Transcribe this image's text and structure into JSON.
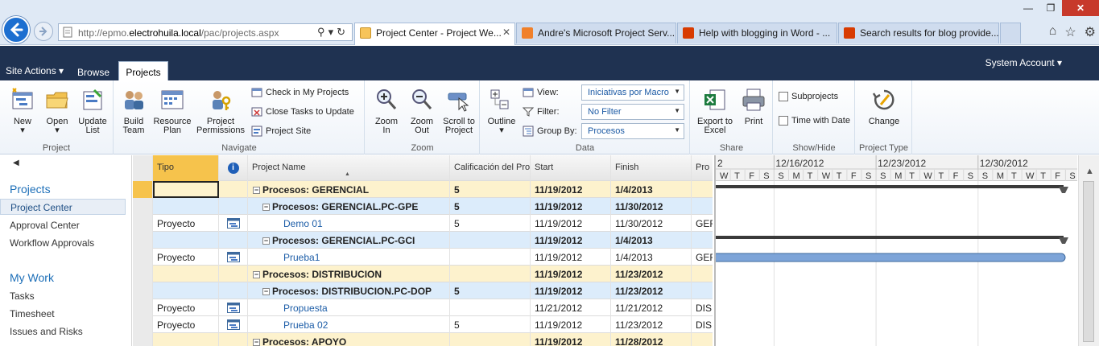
{
  "browser": {
    "url_prefix": "http://epmo.",
    "url_domain": "electrohuila.local",
    "url_path": "/pac/projects.aspx",
    "tabs": [
      {
        "label": "Project Center - Project We...",
        "close": "✕",
        "active": true
      },
      {
        "label": "Andre's Microsoft Project Serv...",
        "active": false
      },
      {
        "label": "Help with blogging in Word - ...",
        "active": false
      },
      {
        "label": "Search results for blog provide...",
        "active": false
      }
    ],
    "window_controls": {
      "minimize": "—",
      "restore": "❐",
      "close": "✕"
    },
    "toolbar_icons": [
      "home-icon",
      "star-icon",
      "gear-icon"
    ]
  },
  "sp_bar": {
    "site_actions": "Site Actions ▾",
    "browse": "Browse",
    "projects_tab": "Projects",
    "account": "System Account ▾"
  },
  "ribbon": {
    "groups": {
      "project": "Project",
      "navigate": "Navigate",
      "zoom": "Zoom",
      "data": "Data",
      "share": "Share",
      "show_hide": "Show/Hide",
      "project_type": "Project Type"
    },
    "new": "New",
    "open": "Open",
    "update_list_1": "Update",
    "update_list_2": "List",
    "build_team_1": "Build",
    "build_team_2": "Team",
    "resource_plan_1": "Resource",
    "resource_plan_2": "Plan",
    "project_permissions_1": "Project",
    "project_permissions_2": "Permissions",
    "check_in": "Check in My Projects",
    "close_tasks": "Close Tasks to Update",
    "project_site": "Project Site",
    "zoom_in_1": "Zoom",
    "zoom_in_2": "In",
    "zoom_out_1": "Zoom",
    "zoom_out_2": "Out",
    "scroll_1": "Scroll to",
    "scroll_2": "Project",
    "outline": "Outline",
    "view_label": "View:",
    "view_value": "Iniciativas por Macro",
    "filter_label": "Filter:",
    "filter_value": "No Filter",
    "groupby_label": "Group By:",
    "groupby_value": "Procesos",
    "export_1": "Export to",
    "export_2": "Excel",
    "print": "Print",
    "subprojects": "Subprojects",
    "time_with_date": "Time with Date",
    "change": "Change"
  },
  "leftnav": {
    "projects_head": "Projects",
    "project_center": "Project Center",
    "approval_center": "Approval Center",
    "workflow_approvals": "Workflow Approvals",
    "my_work_head": "My Work",
    "tasks": "Tasks",
    "timesheet": "Timesheet",
    "issues_risks": "Issues and Risks"
  },
  "grid": {
    "columns": {
      "tipo": "Tipo",
      "info": "i",
      "project_name": "Project Name",
      "calificacion": "Calificación del Pro",
      "start": "Start",
      "finish": "Finish",
      "pro": "Pro"
    },
    "rows": [
      {
        "kind": "summary1",
        "name": "Procesos: GERENCIAL",
        "cal": "5",
        "start": "11/19/2012",
        "finish": "1/4/2013",
        "pro": ""
      },
      {
        "kind": "summary2",
        "name": "Procesos: GERENCIAL.PC-GPE",
        "cal": "5",
        "start": "11/19/2012",
        "finish": "11/30/2012",
        "pro": ""
      },
      {
        "kind": "project",
        "tipo": "Proyecto",
        "name": "Demo 01",
        "cal": "5",
        "start": "11/19/2012",
        "finish": "11/30/2012",
        "pro": "GEF"
      },
      {
        "kind": "summary2",
        "name": "Procesos: GERENCIAL.PC-GCI",
        "cal": "",
        "start": "11/19/2012",
        "finish": "1/4/2013",
        "pro": ""
      },
      {
        "kind": "project",
        "tipo": "Proyecto",
        "name": "Prueba1",
        "cal": "",
        "start": "11/19/2012",
        "finish": "1/4/2013",
        "pro": "GEF"
      },
      {
        "kind": "summary1",
        "name": "Procesos: DISTRIBUCION",
        "cal": "",
        "start": "11/19/2012",
        "finish": "11/23/2012",
        "pro": ""
      },
      {
        "kind": "summary2",
        "name": "Procesos: DISTRIBUCION.PC-DOP",
        "cal": "5",
        "start": "11/19/2012",
        "finish": "11/23/2012",
        "pro": ""
      },
      {
        "kind": "project",
        "tipo": "Proyecto",
        "name": "Propuesta",
        "cal": "",
        "start": "11/21/2012",
        "finish": "11/21/2012",
        "pro": "DIS"
      },
      {
        "kind": "project",
        "tipo": "Proyecto",
        "name": "Prueba 02",
        "cal": "5",
        "start": "11/19/2012",
        "finish": "11/23/2012",
        "pro": "DIS"
      },
      {
        "kind": "summary1",
        "name": "Procesos: APOYO",
        "cal": "",
        "start": "11/19/2012",
        "finish": "11/28/2012",
        "pro": ""
      }
    ]
  },
  "gantt": {
    "weeks": [
      "2",
      "12/16/2012",
      "12/23/2012",
      "12/30/2012"
    ],
    "days": [
      "W",
      "T",
      "F",
      "S",
      "S",
      "M",
      "T",
      "W",
      "T",
      "F",
      "S",
      "S",
      "M",
      "T",
      "W",
      "T",
      "F",
      "S",
      "S",
      "M",
      "T",
      "W",
      "T",
      "F",
      "S",
      "S",
      "M",
      "T",
      "W",
      "T",
      "F",
      "S"
    ]
  },
  "colors": {
    "sp_bar": "#1f3251",
    "summary1": "#fdf2cd",
    "summary2": "#dcecfb",
    "link": "#1e5ea8",
    "gantt_bar": "#7da4d8"
  }
}
